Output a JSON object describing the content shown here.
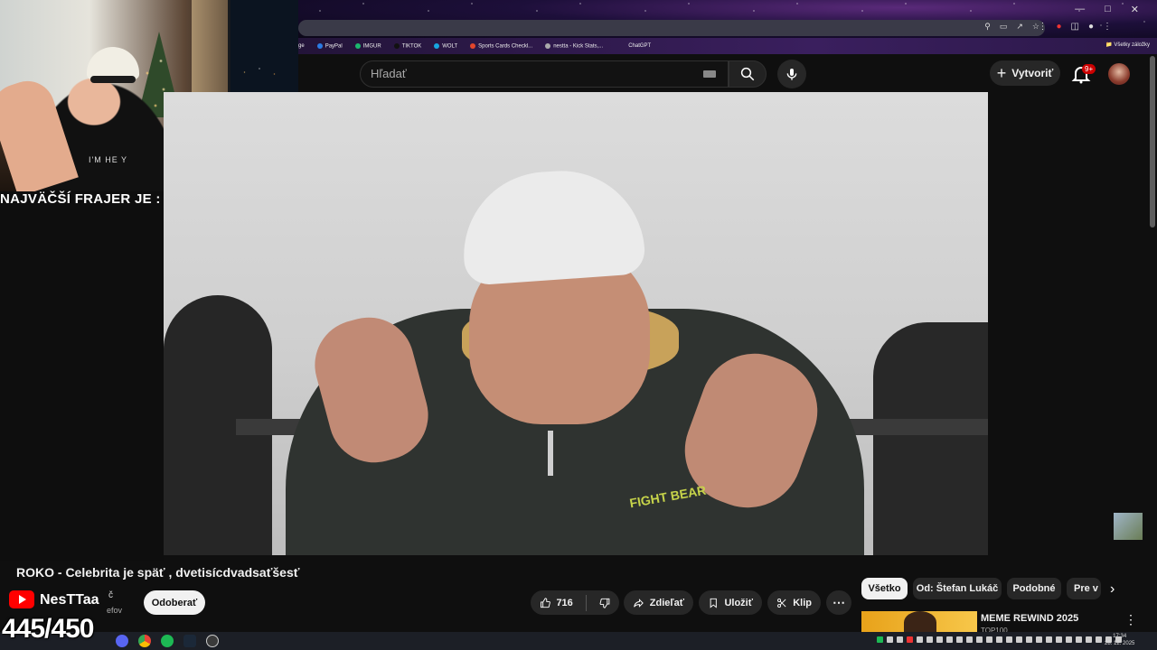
{
  "browser": {
    "bookmarks": [
      "PayPal",
      "IMGUR",
      "TIKTOK",
      "WOLT",
      "Sports Cards Checkl...",
      "nestta - Kick Stats,...",
      "ChatGPT"
    ],
    "bookmarks_prefix": "ge",
    "all_bookmarks": "Všetky záložky"
  },
  "header": {
    "search_placeholder": "Hľadať",
    "create_label": "Vytvoriť",
    "notif_count": "9+"
  },
  "overlay": {
    "caption": "NAJVÄČŠÍ FRAJER JE :",
    "counter": "445/450",
    "webcam_shirt": "I'M HE Y"
  },
  "video": {
    "title": "ROKO - Celebrita je späť , dvetisícdvadsaťšesť",
    "logo_text": "FIGHT BEAR"
  },
  "channel": {
    "name": "NesTTaa",
    "name_suffix": "č",
    "subs": "efov",
    "subscribe_label": "Odoberať"
  },
  "actions": {
    "like_count": "716",
    "share_label": "Zdieľať",
    "save_label": "Uložiť",
    "clip_label": "Klip"
  },
  "chips": [
    "Všetko",
    "Od: Štefan Lukáč",
    "Podobné",
    "Pre v"
  ],
  "recommendation": {
    "title": "MEME REWIND 2025",
    "channel": "TOP100"
  },
  "taskbar": {
    "time": "17:34",
    "date": "28. 12. 2025"
  },
  "colors": {
    "yt_red": "#ff0000",
    "badge_red": "#cc0000",
    "bg": "#0f0f0f"
  }
}
